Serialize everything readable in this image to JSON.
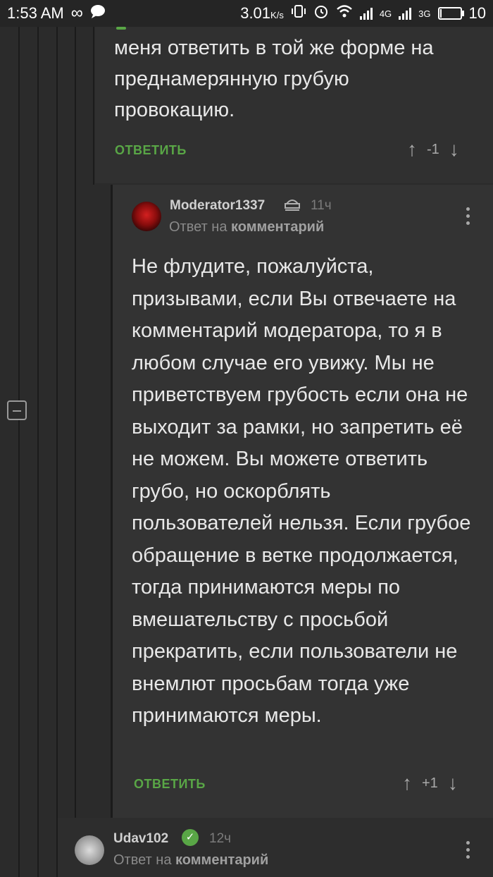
{
  "status_bar": {
    "time": "1:53 AM",
    "speed": "3.01",
    "speed_unit": "K/s",
    "network1": "4G",
    "network2": "3G",
    "battery": "10",
    "battery_level_percent": 10
  },
  "prev_comment": {
    "text": "меня ответить в той же форме на преднамерянную грубую провокацию.",
    "reply_label": "ОТВЕТИТЬ",
    "score": "-1"
  },
  "mod_comment": {
    "username": "Moderator1337",
    "time": "11ч",
    "reply_prefix": "Ответ на",
    "reply_target": "комментарий",
    "text": "Не флудите, пожалуйста, призывами, если Вы отвечаете на комментарий модератора, то я в любом случае его увижу. Мы не приветствуем грубость если она не выходит за рамки, но запретить её не можем. Вы можете ответить грубо, но оскорблять пользователей нельзя. Если грубое обращение в ветке продолжается, тогда принимаются меры по вмешательству с просьбой прекратить, если пользователи не внемлют просьбам тогда уже принимаются меры.",
    "reply_label": "ОТВЕТИТЬ",
    "score": "+1"
  },
  "udav_comment": {
    "username": "Udav102",
    "time": "12ч",
    "reply_prefix": "Ответ на",
    "reply_target": "комментарий"
  },
  "icons": {
    "up": "arrow-up-icon",
    "down": "arrow-down-icon",
    "more": "more-vertical-icon",
    "moderator": "moderator-badge-icon",
    "verified": "check-icon",
    "collapse": "collapse-minus-icon"
  },
  "colors": {
    "accent_green": "#59a646",
    "background": "#2b2b2b"
  }
}
